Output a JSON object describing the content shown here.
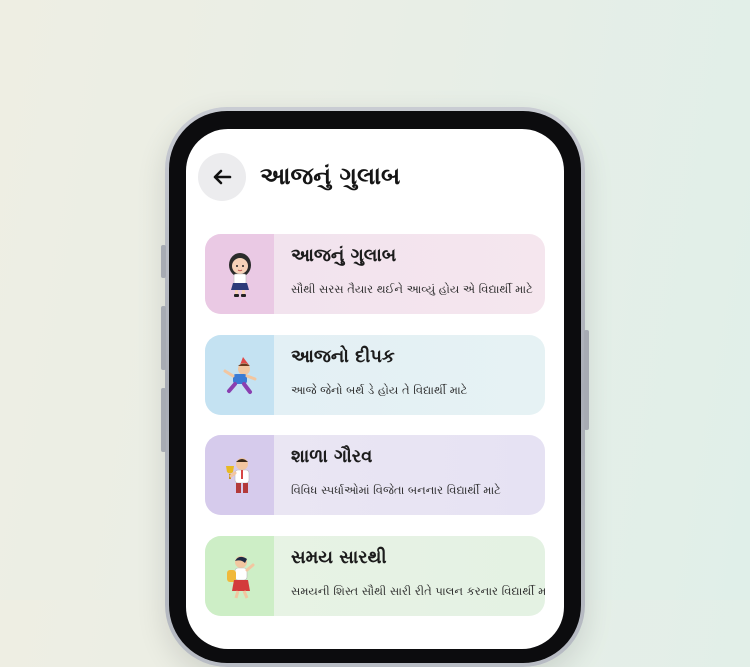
{
  "header": {
    "title": "આજનું ગુલાબ",
    "back_icon": "arrow-left-icon"
  },
  "cards": [
    {
      "title": "આજનું ગુલાબ",
      "subtitle": "સૌથી સરસ તૈયાર થઈને આવ્યું હોય એ વિદ્યાર્થી માટે",
      "icon": "schoolgirl-icon",
      "thumb_color": "#eac9e4",
      "bg_color": "#f3e3ee"
    },
    {
      "title": "આજનો દીપક",
      "subtitle": "આજે જેનો બર્થ ડે હોય તે વિદ્યાર્થી માટે",
      "icon": "birthday-boy-icon",
      "thumb_color": "#c4e2f2",
      "bg_color": "#e4f1f4"
    },
    {
      "title": "શાળા ગૌરવ",
      "subtitle": "વિવિધ સ્પર્ધાઓમાં વિજેતા બનનાર વિદ્યાર્થી માટે",
      "icon": "trophy-boy-icon",
      "thumb_color": "#d6cbec",
      "bg_color": "#e8e3f2"
    },
    {
      "title": "સમય સારથી",
      "subtitle": "સમયની શિસ્ત સૌથી સારી રીતે પાલન કરનાર વિદ્યાર્થી માટે",
      "icon": "running-girl-icon",
      "thumb_color": "#cdeec6",
      "bg_color": "#e6f3e4"
    }
  ]
}
